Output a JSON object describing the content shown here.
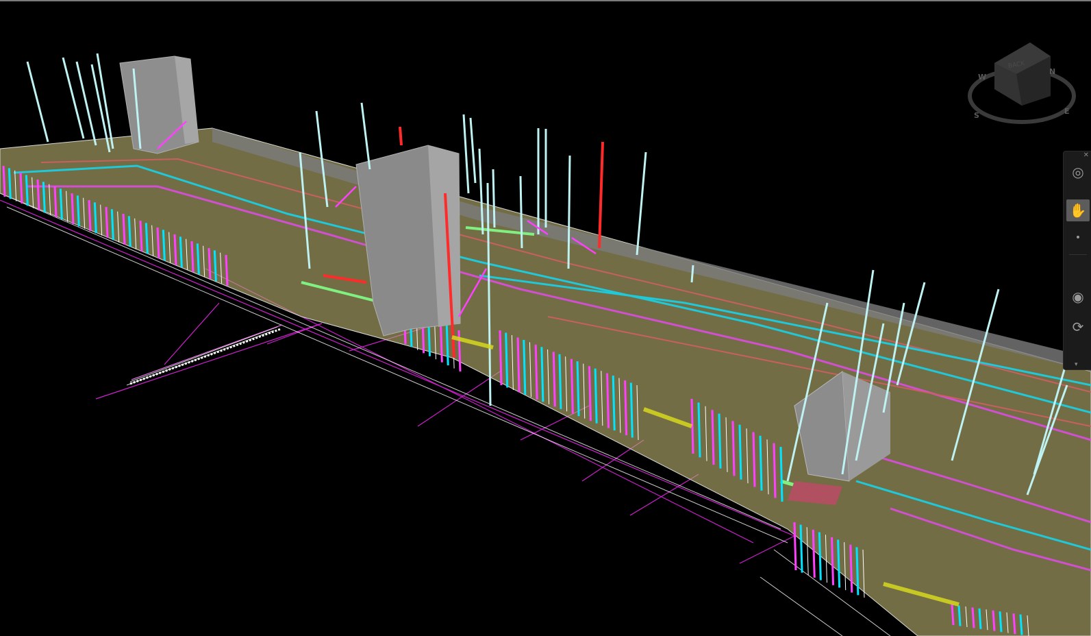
{
  "viewer": {
    "background": "#000000",
    "model_colors": {
      "walls": "#00e5ff",
      "framing": "#ff40ff",
      "floor": "#c8c070",
      "ducts_red": "#ff2a2a",
      "vents": "#b8f0f0",
      "mass": "#8c8c8c",
      "grid": "#d020d0",
      "edge": "#ffffff"
    }
  },
  "viewcube": {
    "face_label": "BACK",
    "compass": {
      "north": "N",
      "south": "S",
      "east": "E",
      "west": "W"
    }
  },
  "navbar": {
    "close_icon": "close-icon",
    "tools": [
      {
        "name": "steeringwheel-icon",
        "glyph": "◎"
      },
      {
        "name": "pan-hand-icon",
        "glyph": "✋",
        "active": true
      },
      {
        "name": "zoom-icon",
        "glyph": "•"
      },
      {
        "name": "orbit-icon",
        "glyph": "◉"
      },
      {
        "name": "lookaround-icon",
        "glyph": "⟳"
      }
    ],
    "menu_icon": "chevron-down-icon"
  }
}
